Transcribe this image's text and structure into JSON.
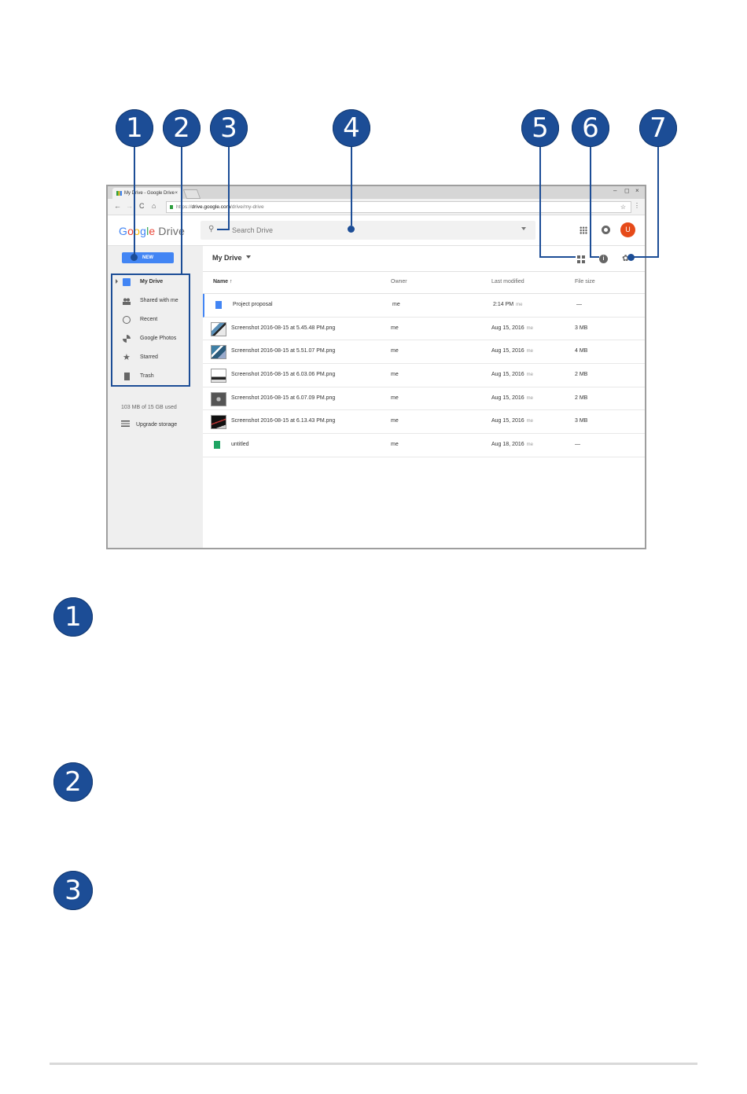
{
  "callouts": {
    "top": [
      "1",
      "2",
      "3",
      "4",
      "5",
      "6",
      "7"
    ],
    "body": [
      "1",
      "2",
      "3"
    ]
  },
  "browser": {
    "tab_title": "My Drive - Google Drive",
    "tab_close": "×",
    "window_controls": [
      "–",
      "◻",
      "×"
    ],
    "nav_buttons": [
      "←",
      "→",
      "C",
      "⌂"
    ],
    "url_prefix": "https://",
    "url_host": "drive.google.com",
    "url_path": "/drive/my-drive",
    "bookmark_icon": "star-icon",
    "menu_icon": "kebab-menu-icon"
  },
  "app": {
    "logo_letters": [
      "G",
      "o",
      "o",
      "g",
      "l",
      "e"
    ],
    "logo_product": "Drive",
    "search_placeholder": "Search Drive",
    "avatar_initial": "U",
    "avatar_color": "#e64a19",
    "accent_color": "#4285f4"
  },
  "sidebar": {
    "new_label": "NEW",
    "items": [
      {
        "label": "My Drive",
        "icon": "drive-icon",
        "active": true
      },
      {
        "label": "Shared with me",
        "icon": "people-icon"
      },
      {
        "label": "Recent",
        "icon": "clock-icon"
      },
      {
        "label": "Google Photos",
        "icon": "photos-icon"
      },
      {
        "label": "Starred",
        "icon": "star-icon"
      },
      {
        "label": "Trash",
        "icon": "trash-icon"
      }
    ],
    "storage": "103 MB of 15 GB used",
    "upgrade": "Upgrade storage"
  },
  "main": {
    "breadcrumb": "My Drive",
    "info_label": "i",
    "gear": "✿",
    "columns": {
      "name": "Name ↑",
      "owner": "Owner",
      "modified": "Last modified",
      "size": "File size"
    },
    "files": [
      {
        "name": "Project proposal",
        "owner": "me",
        "modified": "2:14 PM",
        "by": "me",
        "size": "—"
      },
      {
        "name": "Screenshot 2016-08-15 at 5.45.48 PM.png",
        "owner": "me",
        "modified": "Aug 15, 2016",
        "by": "me",
        "size": "3 MB"
      },
      {
        "name": "Screenshot 2016-08-15 at 5.51.07 PM.png",
        "owner": "me",
        "modified": "Aug 15, 2016",
        "by": "me",
        "size": "4 MB"
      },
      {
        "name": "Screenshot 2016-08-15 at 6.03.06 PM.png",
        "owner": "me",
        "modified": "Aug 15, 2016",
        "by": "me",
        "size": "2 MB"
      },
      {
        "name": "Screenshot 2016-08-15 at 6.07.09 PM.png",
        "owner": "me",
        "modified": "Aug 15, 2016",
        "by": "me",
        "size": "2 MB"
      },
      {
        "name": "Screenshot 2016-08-15 at 6.13.43 PM.png",
        "owner": "me",
        "modified": "Aug 15, 2016",
        "by": "me",
        "size": "3 MB"
      },
      {
        "name": "untitled",
        "owner": "me",
        "modified": "Aug 18, 2016",
        "by": "me",
        "size": "—"
      }
    ]
  },
  "colors": {
    "callout": "#1c4d96"
  }
}
